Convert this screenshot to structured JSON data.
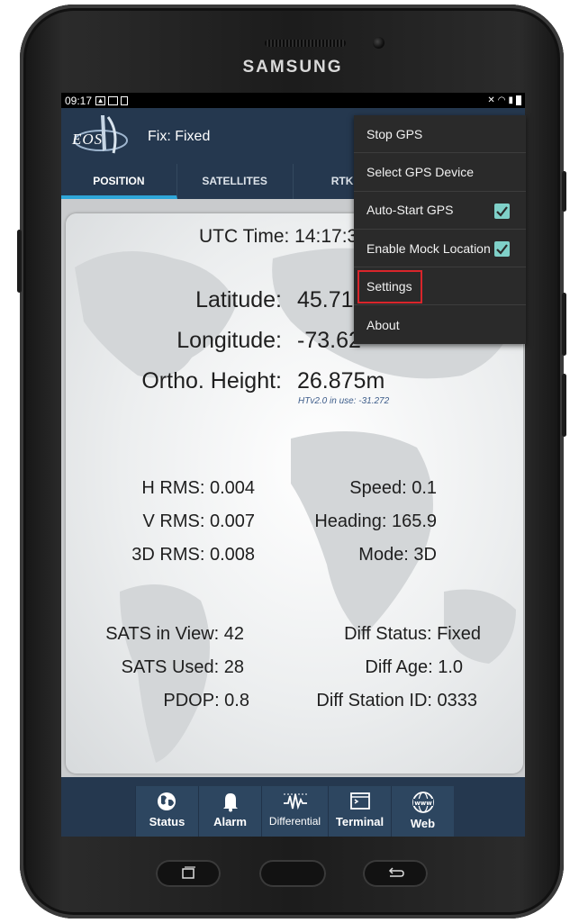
{
  "device": {
    "brand": "SAMSUNG"
  },
  "statusbar": {
    "time": "09:17"
  },
  "appbar": {
    "logo_text": "EOS",
    "fix_label": "Fix: Fixed"
  },
  "tabs": [
    {
      "label": "POSITION",
      "active": true
    },
    {
      "label": "SATELLITES"
    },
    {
      "label": "RTK ST"
    }
  ],
  "position": {
    "utc_label": "UTC Time: 14:17:3",
    "latitude_label": "Latitude:",
    "latitude_value": "45.71",
    "longitude_label": "Longitude:",
    "longitude_value": "-73.62",
    "ortho_label": "Ortho. Height:",
    "ortho_value": "26.875m",
    "htv_note": "HTv2.0 in use: -31.272",
    "h_rms": "H RMS: 0.004",
    "v_rms": "V RMS: 0.007",
    "rms_3d": "3D RMS: 0.008",
    "speed": "Speed: 0.1",
    "heading": "Heading: 165.9",
    "mode": "Mode: 3D",
    "sats_view": "SATS in View: 42",
    "sats_used": "SATS Used: 28",
    "pdop": "PDOP: 0.8",
    "diff_status": "Diff Status: Fixed",
    "diff_age": "Diff Age: 1.0",
    "diff_station": "Diff Station ID: 0333"
  },
  "bottom_nav": {
    "status": "Status",
    "alarm": "Alarm",
    "differential": "Differential",
    "terminal": "Terminal",
    "web": "Web"
  },
  "menu": {
    "items": [
      "Stop GPS",
      "Select GPS Device",
      "Auto-Start GPS",
      "Enable Mock Location",
      "Settings",
      "About"
    ],
    "checked": [
      false,
      false,
      true,
      true,
      false,
      false
    ]
  },
  "colors": {
    "appbar": "#25384f",
    "tab_indicator": "#2ea6d9",
    "menu_bg": "#2a2a2a",
    "checkbox": "#7fd0c8",
    "highlight": "#d9252b"
  }
}
